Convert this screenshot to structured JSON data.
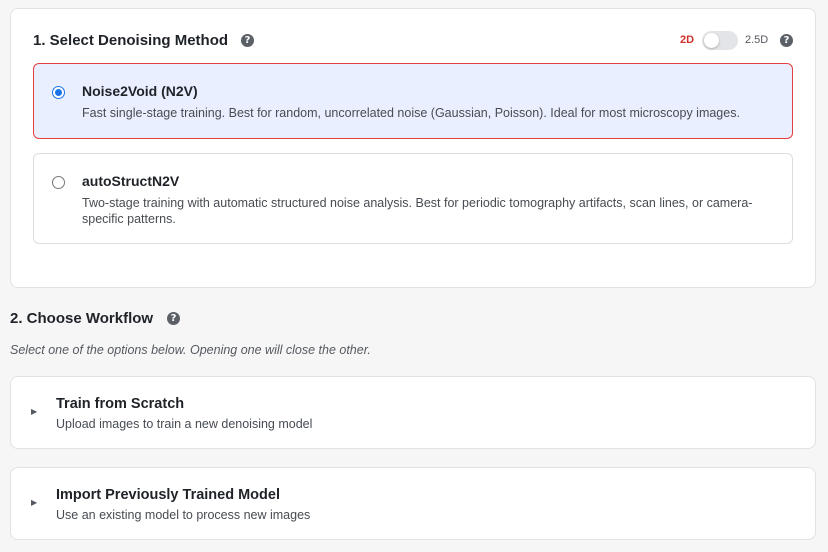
{
  "method_section": {
    "title": "1. Select Denoising Method",
    "help_glyph": "?",
    "mode_toggle": {
      "left_label": "2D",
      "right_label": "2.5D",
      "active": "2D"
    },
    "options": [
      {
        "title": "Noise2Void (N2V)",
        "description": "Fast single-stage training. Best for random, uncorrelated noise (Gaussian, Poisson). Ideal for most microscopy images.",
        "selected": true
      },
      {
        "title": "autoStructN2V",
        "description": "Two-stage training with automatic structured noise analysis. Best for periodic tomography artifacts, scan lines, or camera-specific patterns.",
        "selected": false
      }
    ]
  },
  "workflow_section": {
    "title": "2. Choose Workflow",
    "help_glyph": "?",
    "subtitle": "Select one of the options below. Opening one will close the other.",
    "cards": [
      {
        "caret": "▶",
        "title": "Train from Scratch",
        "description": "Upload images to train a new denoising model"
      },
      {
        "caret": "▶",
        "title": "Import Previously Trained Model",
        "description": "Use an existing model to process new images"
      }
    ]
  },
  "colors": {
    "accent_blue": "#1a73e8",
    "selected_border": "#e04040",
    "selected_bg": "#eaefff",
    "mode_active": "#d0312d"
  }
}
